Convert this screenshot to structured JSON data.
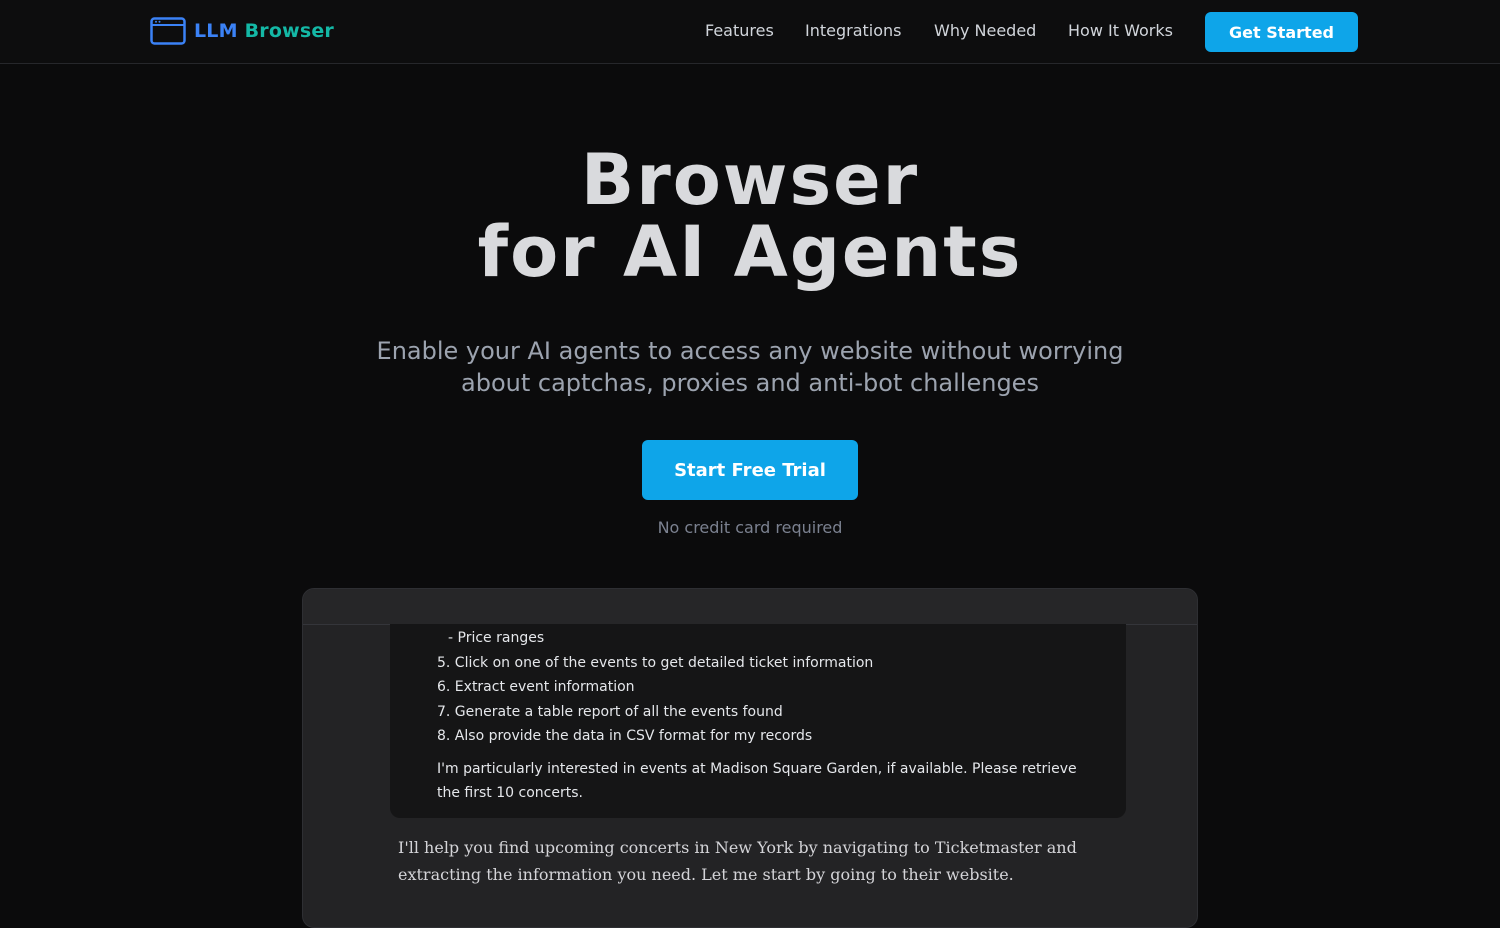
{
  "brand": {
    "llm": "LLM",
    "browser": "Browser",
    "colors": {
      "llm": "#3b82f6",
      "browser": "#14b8a6"
    }
  },
  "nav": {
    "links": [
      "Features",
      "Integrations",
      "Why Needed",
      "How It Works"
    ],
    "cta": "Get Started"
  },
  "hero": {
    "title_line1": "Browser",
    "title_line2": "for AI Agents",
    "subtitle_line1": "Enable your AI agents to access any website without worrying",
    "subtitle_line2": "about captchas, proxies and anti-bot challenges",
    "cta": "Start Free Trial",
    "note": "No credit card required"
  },
  "demo": {
    "prompt_lines": [
      "- Price ranges",
      "5. Click on one of the events to get detailed ticket information",
      "6. Extract event information",
      "7. Generate a table report of all the events found",
      "8. Also provide the data in CSV format for my records",
      "I'm particularly interested in events at Madison Square Garden, if available. Please retrieve",
      "the first 10 concerts."
    ],
    "reply_lines": [
      "I'll help you find upcoming concerts in New York by navigating to Ticketmaster and",
      "extracting the information you need. Let me start by going to their website."
    ]
  },
  "theme": {
    "accent": "#0ea5e9",
    "background": "#0b0b0c"
  }
}
